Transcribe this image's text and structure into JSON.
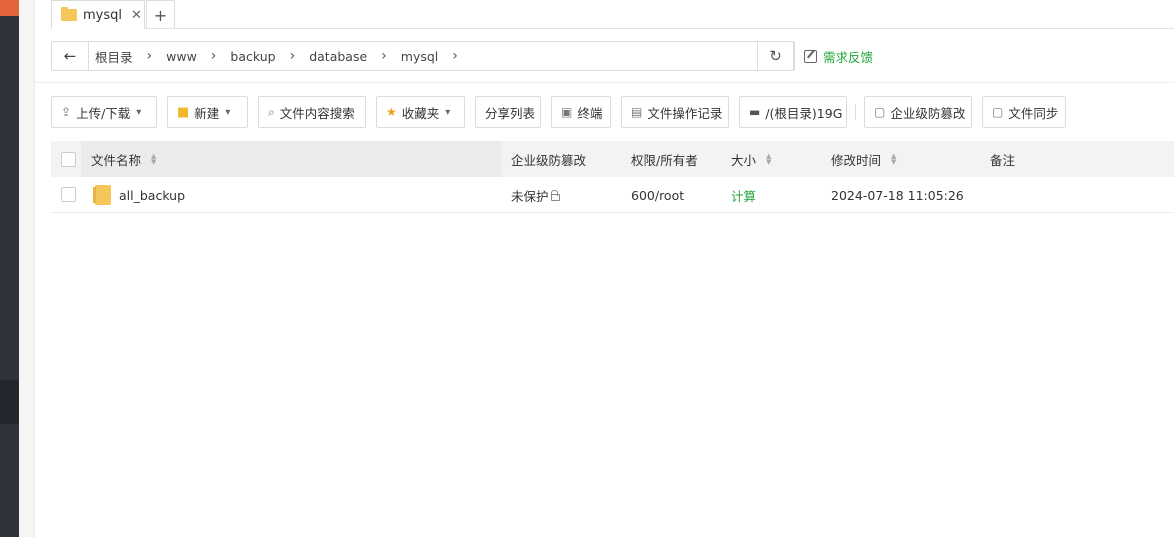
{
  "tab": {
    "label": "mysql",
    "close": "✕",
    "add": "+"
  },
  "breadcrumb": {
    "back": "←",
    "items": [
      "根目录",
      "www",
      "backup",
      "database",
      "mysql"
    ],
    "sep": "›",
    "refresh": "↻"
  },
  "feedback": {
    "label": "需求反馈"
  },
  "toolbar": {
    "upload": "上传/下载",
    "new": "新建",
    "search": "文件内容搜索",
    "favorites": "收藏夹",
    "share": "分享列表",
    "terminal": "终端",
    "oplog": "文件操作记录",
    "disk": "/(根目录)19G",
    "tamper": "企业级防篡改",
    "sync": "文件同步"
  },
  "table": {
    "headers": {
      "name": "文件名称",
      "tamper": "企业级防篡改",
      "perm": "权限/所有者",
      "size": "大小",
      "mtime": "修改时间",
      "note": "备注"
    },
    "rows": [
      {
        "name": "all_backup",
        "tamper": "未保护",
        "perm": "600/root",
        "size": "计算",
        "mtime": "2024-07-18 11:05:26",
        "note": ""
      }
    ]
  },
  "colors": {
    "accent": "#20a53a",
    "folder": "#f5c75a",
    "sidebar": "#2f343c"
  }
}
